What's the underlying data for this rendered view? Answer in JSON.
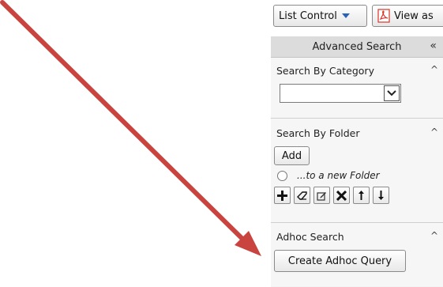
{
  "toolbar": {
    "list_control_label": "List Control",
    "view_label": "View as",
    "view_icon": "pdf-icon"
  },
  "panel": {
    "title": "Advanced Search",
    "collapse_icon": "«",
    "sections": {
      "category": {
        "title": "Search By Category",
        "caret": "^",
        "select_value": ""
      },
      "folder": {
        "title": "Search By Folder",
        "caret": "^",
        "add_label": "Add",
        "radio_label": "...to a new Folder",
        "tools": [
          "plus-icon",
          "eraser-icon",
          "edit-icon",
          "delete-icon",
          "move-up-icon",
          "move-down-icon"
        ]
      },
      "adhoc": {
        "title": "Adhoc Search",
        "caret": "^",
        "button_label": "Create Adhoc Query"
      }
    }
  },
  "annotation": {
    "arrow_color": "#c9433f"
  },
  "colors": {
    "accent": "#2a62b8",
    "panel_bg": "#f4f4f4",
    "header_bg": "#dcdcdc",
    "pdf_red": "#d8342b"
  }
}
